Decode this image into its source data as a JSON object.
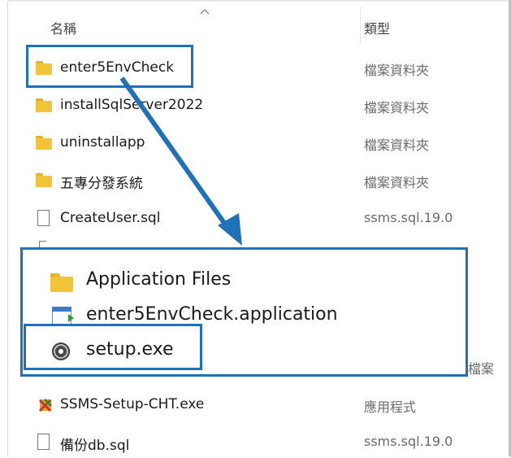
{
  "header": {
    "name_column": "名稱",
    "type_column": "類型"
  },
  "rows": [
    {
      "name": "enter5EnvCheck",
      "type": "檔案資料夾",
      "icon": "folder-icon"
    },
    {
      "name": "installSqlServer2022",
      "type": "檔案資料夾",
      "icon": "folder-icon"
    },
    {
      "name": "uninstallapp",
      "type": "檔案資料夾",
      "icon": "folder-icon"
    },
    {
      "name": "五專分發系統",
      "type": "檔案資料夾",
      "icon": "folder-icon"
    },
    {
      "name": "CreateUser.sql",
      "type": "ssms.sql.19.0",
      "icon": "file-icon"
    },
    {
      "name": "SSMS-Setup-CHT.exe",
      "type": "應用程式",
      "icon": "ssms-setup-icon"
    },
    {
      "name": "備份db.sql",
      "type": "ssms.sql.19.0",
      "icon": "file-icon"
    }
  ],
  "peek_text": "檔案",
  "popup": {
    "items": [
      {
        "name": "Application Files",
        "icon": "folder-icon"
      },
      {
        "name": "enter5EnvCheck.application",
        "icon": "application-manifest-icon"
      },
      {
        "name": "setup.exe",
        "icon": "setup-disc-icon"
      }
    ]
  },
  "colors": {
    "highlight_border": "#1f72b8",
    "arrow": "#1f72b8",
    "folder": "#f3c43a",
    "type_text": "#6b6b6b"
  }
}
